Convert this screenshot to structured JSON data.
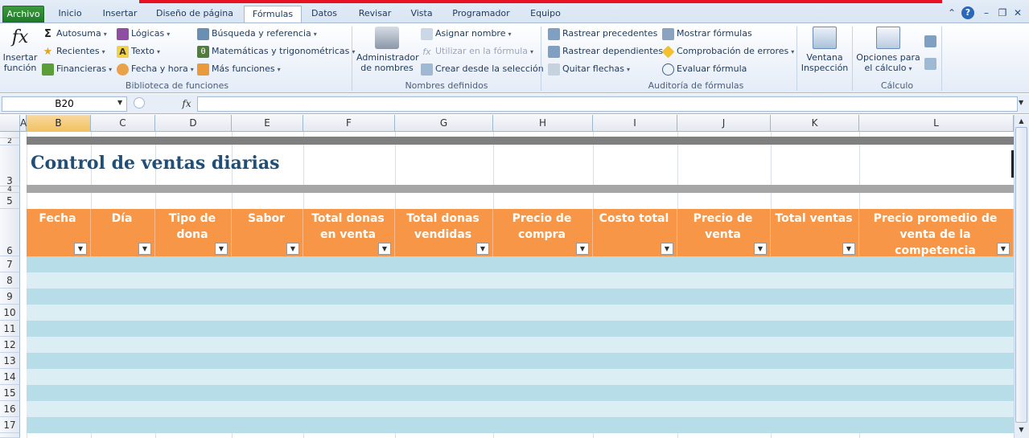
{
  "tabs": {
    "file": "Archivo",
    "items": [
      "Inicio",
      "Insertar",
      "Diseño de página",
      "Fórmulas",
      "Datos",
      "Revisar",
      "Vista",
      "Programador",
      "Equipo"
    ],
    "active": "Fórmulas"
  },
  "ribbon": {
    "insert_function": [
      "Insertar",
      "función"
    ],
    "lib": {
      "autosuma": "Autosuma",
      "recientes": "Recientes",
      "financieras": "Financieras",
      "logicas": "Lógicas",
      "texto": "Texto",
      "fecha": "Fecha y hora",
      "busqueda": "Búsqueda y referencia",
      "matematicas": "Matemáticas y trigonométricas",
      "mas": "Más funciones",
      "label": "Biblioteca de funciones"
    },
    "names": {
      "admin": [
        "Administrador",
        "de nombres"
      ],
      "asignar": "Asignar nombre",
      "utilizar": "Utilizar en la fórmula",
      "crear": "Crear desde la selección",
      "label": "Nombres definidos"
    },
    "audit": {
      "precedentes": "Rastrear precedentes",
      "dependientes": "Rastrear dependientes",
      "quitar": "Quitar flechas",
      "mostrar": "Mostrar fórmulas",
      "comprobacion": "Comprobación de errores",
      "evaluar": "Evaluar fórmula",
      "ventana": [
        "Ventana",
        "Inspección"
      ],
      "label": "Auditoría de fórmulas"
    },
    "calc": {
      "opciones": [
        "Opciones para",
        "el cálculo"
      ],
      "label": "Cálculo"
    }
  },
  "formula_bar": {
    "name_box": "B20",
    "fx": "fx",
    "value": ""
  },
  "columns": [
    "A",
    "B",
    "C",
    "D",
    "E",
    "F",
    "G",
    "H",
    "I",
    "J",
    "K",
    "L"
  ],
  "selected_column": "B",
  "rows": [
    "2",
    "3",
    "4",
    "5",
    "6",
    "7",
    "8",
    "9",
    "10",
    "11",
    "12",
    "13",
    "14",
    "15",
    "16",
    "17"
  ],
  "sheet": {
    "title": "Control de ventas diarias",
    "headers": [
      "Fecha",
      "Día",
      "Tipo de dona",
      "Sabor",
      "Total donas en venta",
      "Total donas vendidas",
      "Precio de compra",
      "Costo total",
      "Precio de venta",
      "Total ventas",
      "Precio promedio de venta de la competencia"
    ]
  },
  "colors": {
    "header": "#f79646",
    "band_dark": "#b7dde8",
    "band_light": "#daeef3",
    "title": "#1f4e79"
  }
}
